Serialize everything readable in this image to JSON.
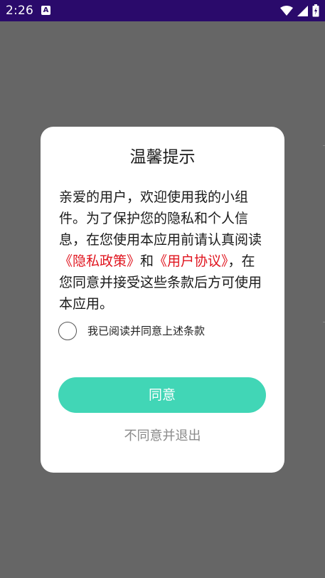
{
  "status_bar": {
    "time": "2:26",
    "app_icon_letter": "A",
    "background_color": "#2a0a6b"
  },
  "dialog": {
    "title": "温馨提示",
    "body": {
      "part1": "亲爱的用户，欢迎使用我的小组件。为了保护您的隐私和个人信息，在您使用本应用前请认真阅读",
      "privacy_link": "《隐私政策》",
      "part2": "和",
      "agreement_link": "《用户协议》",
      "part3": "，在您同意并接受这些条款后方可使用本应用。"
    },
    "checkbox_label": "我已阅读并同意上述条款",
    "checkbox_checked": false,
    "agree_button_label": "同意",
    "disagree_link_label": "不同意并退出"
  },
  "colors": {
    "accent": "#41d6b6",
    "link": "#e0141e",
    "overlay": "#666666",
    "muted_text": "#8a8a8a"
  },
  "icons": [
    "wifi-icon",
    "signal-icon",
    "battery-icon",
    "app-notification-icon"
  ]
}
